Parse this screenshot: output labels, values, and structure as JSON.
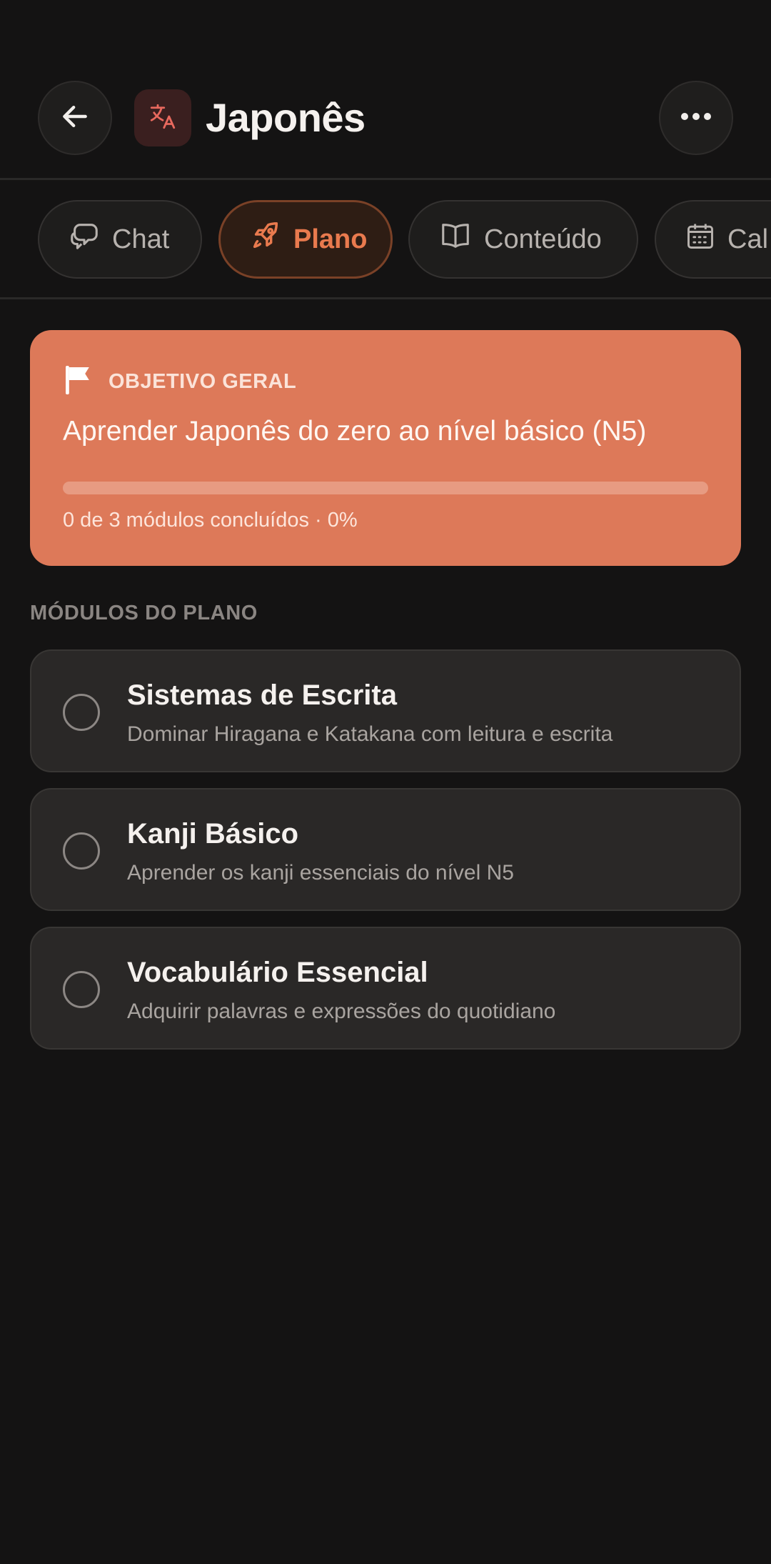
{
  "header": {
    "title": "Japonês",
    "back_icon": "arrow-left-icon",
    "app_icon": "translate-icon",
    "more_icon": "ellipsis-icon"
  },
  "tabs": [
    {
      "label": "Chat",
      "icon": "chat-bubbles-icon",
      "active": false
    },
    {
      "label": "Plano",
      "icon": "rocket-icon",
      "active": true
    },
    {
      "label": "Conteúdo",
      "icon": "book-open-icon",
      "active": false
    },
    {
      "label": "Cal",
      "icon": "calendar-icon",
      "active": false
    }
  ],
  "goal": {
    "label": "OBJETIVO GERAL",
    "icon": "flag-icon",
    "text": "Aprender Japonês do zero ao nível básico (N5)",
    "progress": 0,
    "status": "0 de 3 módulos concluídos · 0%"
  },
  "section_title": "MÓDULOS DO PLANO",
  "modules": [
    {
      "title": "Sistemas de Escrita",
      "description": "Dominar Hiragana e Katakana com leitura e escrita",
      "done": false
    },
    {
      "title": "Kanji Básico",
      "description": "Aprender os kanji essenciais do nível N5",
      "done": false
    },
    {
      "title": "Vocabulário Essencial",
      "description": "Adquirir palavras e expressões do quotidiano",
      "done": false
    }
  ],
  "colors": {
    "background": "#141313",
    "accent": "#dd7959",
    "active_tab_text": "#e97a4e"
  }
}
